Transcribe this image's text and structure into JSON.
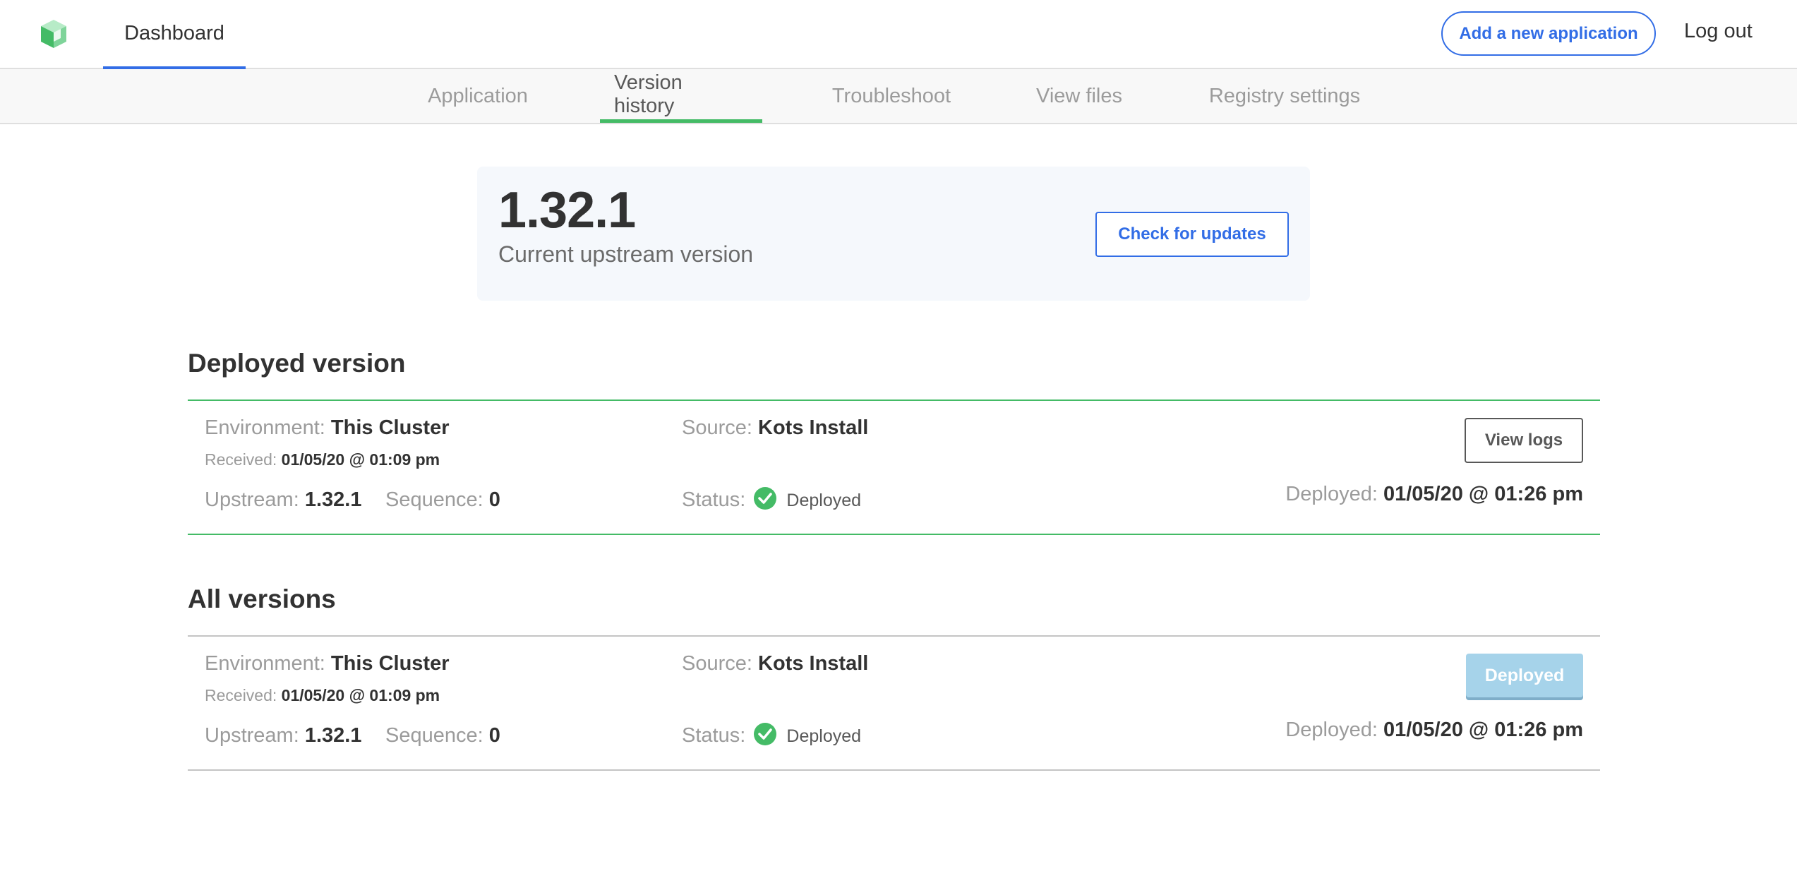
{
  "topnav": {
    "logo_icon": "kots-cube-logo-icon",
    "dashboard_label": "Dashboard",
    "add_app_label": "Add a new application",
    "logout_label": "Log out"
  },
  "subnav": {
    "tabs": [
      {
        "label": "Application",
        "active": false
      },
      {
        "label": "Version history",
        "active": true
      },
      {
        "label": "Troubleshoot",
        "active": false
      },
      {
        "label": "View files",
        "active": false
      },
      {
        "label": "Registry settings",
        "active": false
      }
    ]
  },
  "upstream": {
    "version": "1.32.1",
    "label": "Current upstream version",
    "check_button": "Check for updates"
  },
  "deployed_section": {
    "title": "Deployed version",
    "row": {
      "environment_label": "Environment:",
      "environment": "This Cluster",
      "received_label": "Received:",
      "received": "01/05/20 @ 01:09 pm",
      "upstream_label": "Upstream:",
      "upstream": "1.32.1",
      "sequence_label": "Sequence:",
      "sequence": "0",
      "source_label": "Source:",
      "source": "Kots Install",
      "status_label": "Status:",
      "status": "Deployed",
      "action_button": "View logs",
      "deployed_label": "Deployed:",
      "deployed": "01/05/20 @ 01:26 pm"
    }
  },
  "all_section": {
    "title": "All versions",
    "row": {
      "environment_label": "Environment:",
      "environment": "This Cluster",
      "received_label": "Received:",
      "received": "01/05/20 @ 01:09 pm",
      "upstream_label": "Upstream:",
      "upstream": "1.32.1",
      "sequence_label": "Sequence:",
      "sequence": "0",
      "source_label": "Source:",
      "source": "Kots Install",
      "status_label": "Status:",
      "status": "Deployed",
      "action_button": "Deployed",
      "deployed_label": "Deployed:",
      "deployed": "01/05/20 @ 01:26 pm"
    }
  },
  "colors": {
    "accent_blue": "#326de6",
    "success_green": "#44bb66",
    "muted_gray": "#9b9b9b",
    "disabled_button": "#a6d3ea"
  }
}
